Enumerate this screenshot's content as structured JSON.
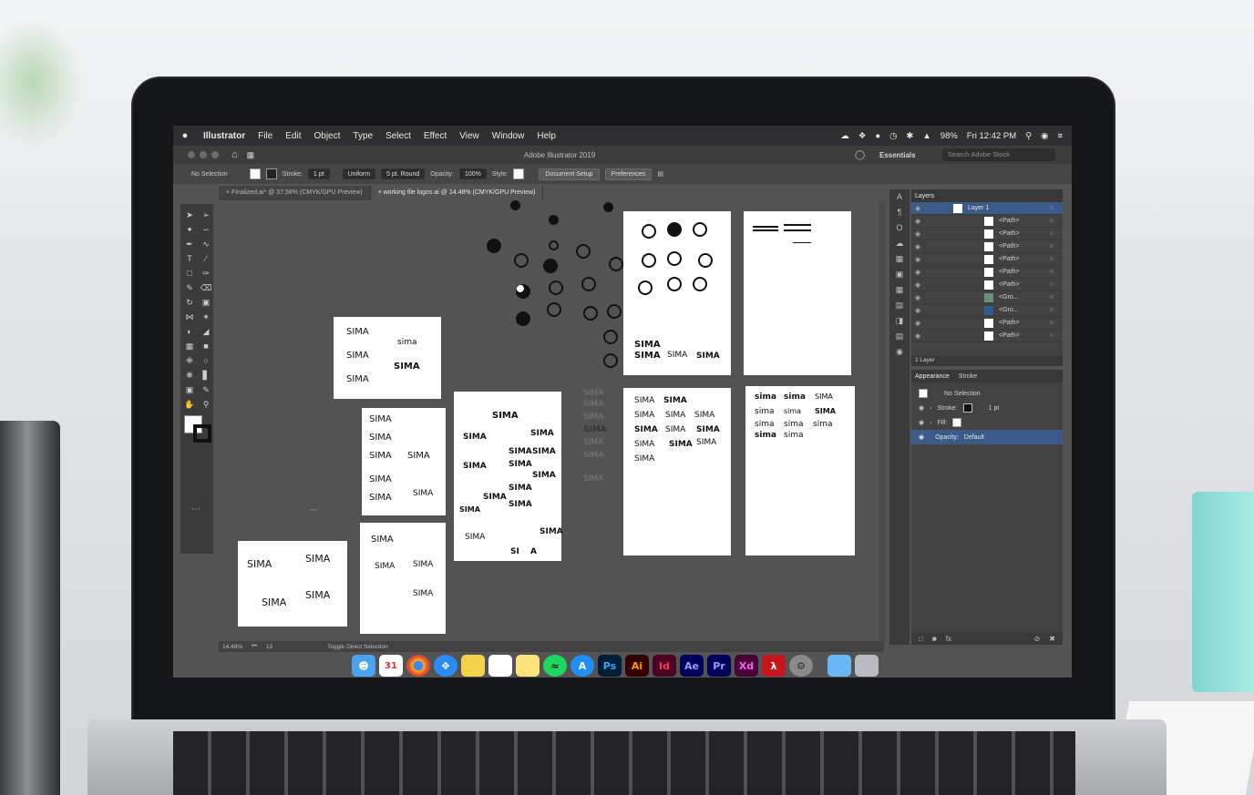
{
  "menubar": {
    "apple": "",
    "items": [
      "Illustrator",
      "File",
      "Edit",
      "Object",
      "Type",
      "Select",
      "Effect",
      "View",
      "Window",
      "Help"
    ],
    "battery": "98%",
    "clock": "Fri 12:42 PM"
  },
  "titlebar": {
    "title": "Adobe Illustrator 2019",
    "workspace": "Essentials",
    "search_placeholder": "Search Adobe Stock"
  },
  "control": {
    "selection": "No Selection",
    "stroke_label": "Stroke:",
    "stroke_value": "1 pt",
    "profile": "Uniform",
    "brush": "5 pt. Round",
    "opacity_label": "Opacity:",
    "opacity_value": "100%",
    "style_label": "Style:",
    "doc_setup": "Document Setup",
    "preferences": "Preferences"
  },
  "tabs": [
    {
      "label": "Finalized.ai* @ 37.58% (CMYK/GPU Preview)"
    },
    {
      "label": "working file logos.ai @ 14.48% (CMYK/GPU Preview)"
    }
  ],
  "status": {
    "zoom": "14.48%",
    "artboard": "13",
    "tool_hint": "Toggle Direct Selection"
  },
  "artwork": {
    "wordmark_upper": "SIMA",
    "wordmark_lower": "sima",
    "wordmark_split1": "SI",
    "wordmark_split2": "MA",
    "wordmark_split3": "A"
  },
  "layers": {
    "tab": "Layers",
    "layer_name": "Layer 1",
    "rows": [
      "<Path>",
      "<Path>",
      "<Path>",
      "<Path>",
      "<Path>",
      "<Path>",
      "<Gro...",
      "<Gro...",
      "<Path>",
      "<Path>"
    ],
    "footer": "1 Layer"
  },
  "appearance": {
    "tab": "Appearance",
    "tab2": "Stroke",
    "header": "No Selection",
    "stroke_label": "Stroke:",
    "stroke_value": "1 pt",
    "fill_label": "Fill:",
    "opacity_label": "Opacity:",
    "opacity_value": "Default"
  },
  "dock": {
    "apps": [
      "Ps",
      "Ai",
      "Id",
      "Ae",
      "Pr",
      "Xd"
    ],
    "calendar_day": "31"
  },
  "colors": {
    "ps": "#31a8ff",
    "ai": "#ff9a00",
    "id": "#ff3366",
    "ae": "#9999ff",
    "pr": "#9999ff",
    "xd": "#ff61f6",
    "panel_highlight": "#3c5a86"
  }
}
